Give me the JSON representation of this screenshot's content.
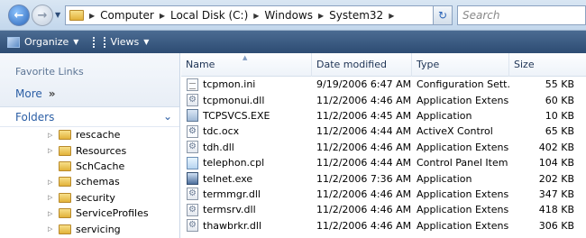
{
  "address": {
    "crumbs": [
      "Computer",
      "Local Disk (C:)",
      "Windows",
      "System32"
    ],
    "search_placeholder": "Search"
  },
  "toolbar": {
    "organize_label": "Organize",
    "views_label": "Views"
  },
  "nav": {
    "favorite_links_title": "Favorite Links",
    "more_label": "More",
    "folders_title": "Folders",
    "folders": [
      "rescache",
      "Resources",
      "SchCache",
      "schemas",
      "security",
      "ServiceProfiles",
      "servicing"
    ]
  },
  "columns": {
    "name": "Name",
    "date": "Date modified",
    "type": "Type",
    "size": "Size"
  },
  "files": [
    {
      "icon": "ini-file-icon",
      "name": "tcpmon.ini",
      "date": "9/19/2006 6:47 AM",
      "type": "Configuration Sett...",
      "size": "55 KB"
    },
    {
      "icon": "dll-file-icon",
      "name": "tcpmonui.dll",
      "date": "11/2/2006 4:46 AM",
      "type": "Application Extens...",
      "size": "60 KB"
    },
    {
      "icon": "exe-file-icon",
      "name": "TCPSVCS.EXE",
      "date": "11/2/2006 4:45 AM",
      "type": "Application",
      "size": "10 KB"
    },
    {
      "icon": "ocx-file-icon",
      "name": "tdc.ocx",
      "date": "11/2/2006 4:44 AM",
      "type": "ActiveX Control",
      "size": "65 KB"
    },
    {
      "icon": "dll-file-icon",
      "name": "tdh.dll",
      "date": "11/2/2006 4:46 AM",
      "type": "Application Extens...",
      "size": "402 KB"
    },
    {
      "icon": "cpl-file-icon",
      "name": "telephon.cpl",
      "date": "11/2/2006 4:44 AM",
      "type": "Control Panel Item",
      "size": "104 KB"
    },
    {
      "icon": "telnet-exe-icon",
      "name": "telnet.exe",
      "date": "11/2/2006 7:36 AM",
      "type": "Application",
      "size": "202 KB"
    },
    {
      "icon": "dll-file-icon",
      "name": "termmgr.dll",
      "date": "11/2/2006 4:46 AM",
      "type": "Application Extens...",
      "size": "347 KB"
    },
    {
      "icon": "dll-file-icon",
      "name": "termsrv.dll",
      "date": "11/2/2006 4:46 AM",
      "type": "Application Extens...",
      "size": "418 KB"
    },
    {
      "icon": "dll-file-icon",
      "name": "thawbrkr.dll",
      "date": "11/2/2006 4:46 AM",
      "type": "Application Extens...",
      "size": "306 KB"
    }
  ]
}
